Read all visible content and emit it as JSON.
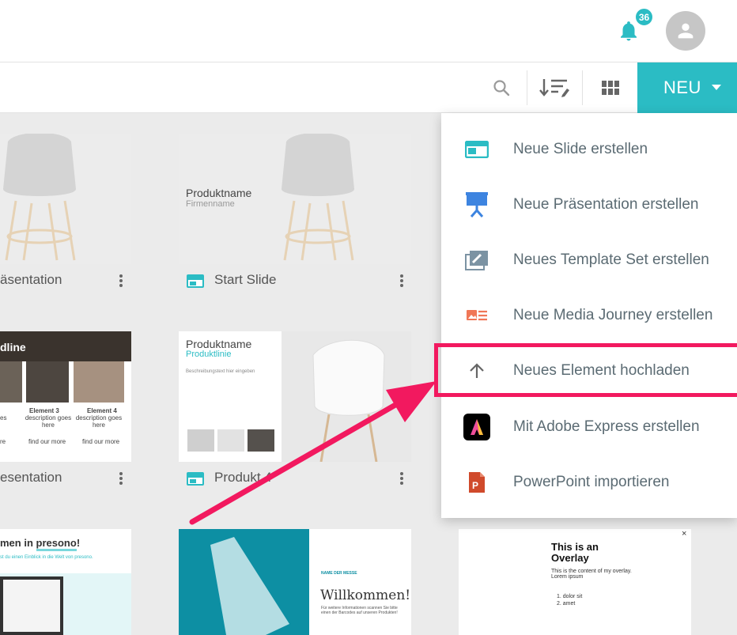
{
  "header": {
    "notification_count": "36",
    "notification_icon": "bell-icon",
    "avatar_icon": "person-icon"
  },
  "toolbar": {
    "search_icon": "search-icon",
    "sort_icon": "sort-icon",
    "grid_icon": "grid-view-icon",
    "new_label": "NEU"
  },
  "cards": [
    {
      "title": "äsentation",
      "type": "presentation"
    },
    {
      "title": "Start Slide",
      "type": "slide",
      "thumb_title": "Produktname",
      "thumb_subtitle": "Firmenname"
    },
    {
      "title": "esentation",
      "type": "presentation",
      "thumb_heading": "dline",
      "el3": "Element 3",
      "el3_desc": "description goes here",
      "el4": "Element 4",
      "el4_desc": "description goes here",
      "find_more": "find our more",
      "left_desc": "es",
      "left_here": "re"
    },
    {
      "title": "Produkt 4",
      "type": "slide",
      "thumb_title": "Produktname",
      "thumb_subtitle": "Produktlinie",
      "thumb_desc": "Beschreibungstext hier eingeben"
    },
    {
      "thumb_heading_pre": "men in ",
      "thumb_heading_brand": "presono",
      "thumb_heading_post": "!",
      "thumb_sub": "st du einen Einblick in die Welt von presono."
    },
    {
      "thumb_label": "NAME DER MESSE",
      "thumb_title": "Willkommen!",
      "thumb_text": "Für weitere Informationen scannen Sie bitte einen der Barcodes auf unseren Produkten!"
    },
    {
      "thumb_title": "This is an Overlay",
      "thumb_text": "This is the content of my overlay. Lorem ipsum",
      "list_1": "1. dolor sit",
      "list_2": "2. amet",
      "close": "×"
    }
  ],
  "menu": {
    "items": [
      {
        "label": "Neue Slide erstellen",
        "icon": "slide-icon",
        "color": "#2bbcc4"
      },
      {
        "label": "Neue Präsentation erstellen",
        "icon": "presentation-icon",
        "color": "#3d84e0"
      },
      {
        "label": "Neues Template Set erstellen",
        "icon": "template-icon",
        "color": "#7c93a3"
      },
      {
        "label": "Neue Media Journey erstellen",
        "icon": "media-journey-icon",
        "color": "#f07757"
      },
      {
        "label": "Neues Element hochladen",
        "icon": "upload-arrow-icon",
        "color": "#666666"
      },
      {
        "label": "Mit Adobe Express erstellen",
        "icon": "adobe-express-icon",
        "color": "#000000"
      },
      {
        "label": "PowerPoint importieren",
        "icon": "powerpoint-icon",
        "color": "#d04a2b"
      }
    ]
  },
  "colors": {
    "accent": "#2bbcc4",
    "highlight": "#f2195f"
  }
}
